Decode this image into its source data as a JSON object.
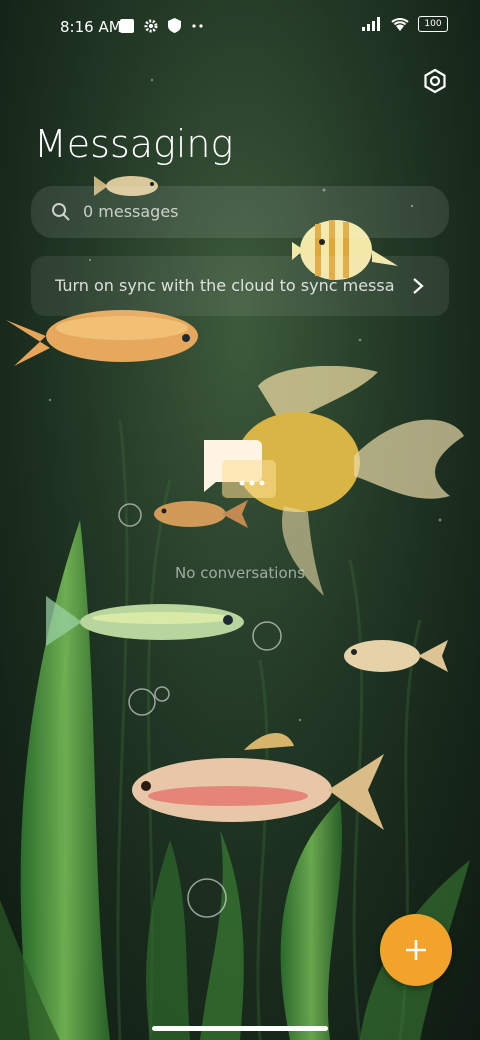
{
  "status_bar": {
    "time": "8:16 AM",
    "battery": "100",
    "icons": [
      "notification-square-icon",
      "gear-icon",
      "shield-icon",
      "more-dots-icon",
      "signal-icon",
      "wifi-icon",
      "battery-icon"
    ]
  },
  "header": {
    "title": "Messaging",
    "settings_icon": "settings-icon"
  },
  "search": {
    "placeholder": "0 messages",
    "icon": "search-icon"
  },
  "sync_banner": {
    "text": "Turn on sync with the cloud to sync messages",
    "icon": "chevron-right-icon"
  },
  "empty_state": {
    "icon": "conversation-bubble-icon",
    "text": "No conversations"
  },
  "fab": {
    "icon": "plus-icon",
    "color": "#f2a42a"
  },
  "colors": {
    "background": "#1e3322",
    "accent": "#f2a42a"
  }
}
